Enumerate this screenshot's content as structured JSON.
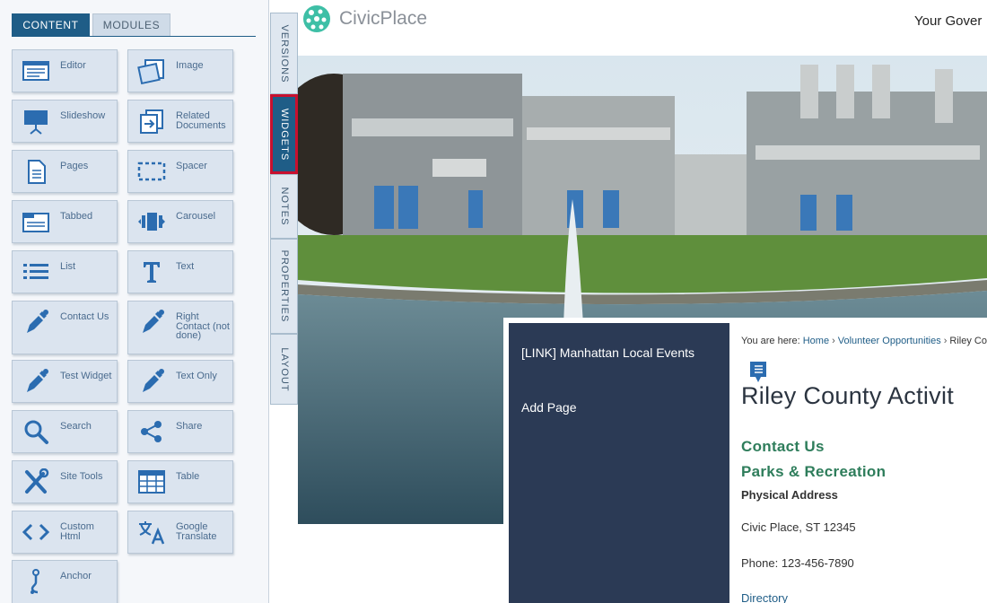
{
  "panel": {
    "tabs": [
      {
        "label": "CONTENT",
        "active": true
      },
      {
        "label": "MODULES",
        "active": false
      }
    ],
    "widgets": [
      {
        "label": "Editor",
        "icon": "editor-icon"
      },
      {
        "label": "Image",
        "icon": "image-icon"
      },
      {
        "label": "Slideshow",
        "icon": "slideshow-icon"
      },
      {
        "label": "Related Documents",
        "icon": "related-documents-icon"
      },
      {
        "label": "Pages",
        "icon": "pages-icon"
      },
      {
        "label": "Spacer",
        "icon": "spacer-icon"
      },
      {
        "label": "Tabbed",
        "icon": "tabbed-icon"
      },
      {
        "label": "Carousel",
        "icon": "carousel-icon"
      },
      {
        "label": "List",
        "icon": "list-icon"
      },
      {
        "label": "Text",
        "icon": "text-icon"
      },
      {
        "label": "Contact Us",
        "icon": "contact-us-icon"
      },
      {
        "label": "Right Contact (not done)",
        "icon": "right-contact-icon"
      },
      {
        "label": "Test Widget",
        "icon": "test-widget-icon"
      },
      {
        "label": "Text Only",
        "icon": "text-only-icon"
      },
      {
        "label": "Search",
        "icon": "search-icon"
      },
      {
        "label": "Share",
        "icon": "share-icon"
      },
      {
        "label": "Site Tools",
        "icon": "site-tools-icon"
      },
      {
        "label": "Table",
        "icon": "table-icon"
      },
      {
        "label": "Custom Html",
        "icon": "code-icon"
      },
      {
        "label": "Google Translate",
        "icon": "translate-icon"
      },
      {
        "label": "Anchor",
        "icon": "anchor-icon"
      }
    ]
  },
  "side_tabs": [
    {
      "label": "VERSIONS",
      "active": false
    },
    {
      "label": "WIDGETS",
      "active": true
    },
    {
      "label": "NOTES",
      "active": false
    },
    {
      "label": "PROPERTIES",
      "active": false
    },
    {
      "label": "LAYOUT",
      "active": false
    }
  ],
  "site": {
    "logo_text": "CivicPlace",
    "tagline": "Your Gover",
    "sidenav": [
      "[LINK] Manhattan Local Events",
      "Add Page"
    ],
    "breadcrumb": {
      "prefix": "You are here:",
      "items": [
        "Home",
        "Volunteer Opportunities",
        "Riley Co"
      ]
    },
    "page_title": "Riley County Activit",
    "contact_heading": "Contact Us",
    "department": "Parks & Recreation",
    "address_label": "Physical Address",
    "address": "Civic Place, ST 12345",
    "phone": "Phone: 123-456-7890",
    "directory_link": "Directory"
  },
  "colors": {
    "brand_blue": "#1f5d87",
    "nav_navy": "#2b3a55",
    "heading_green": "#2e7d5b",
    "highlight_red": "#c8102e"
  }
}
